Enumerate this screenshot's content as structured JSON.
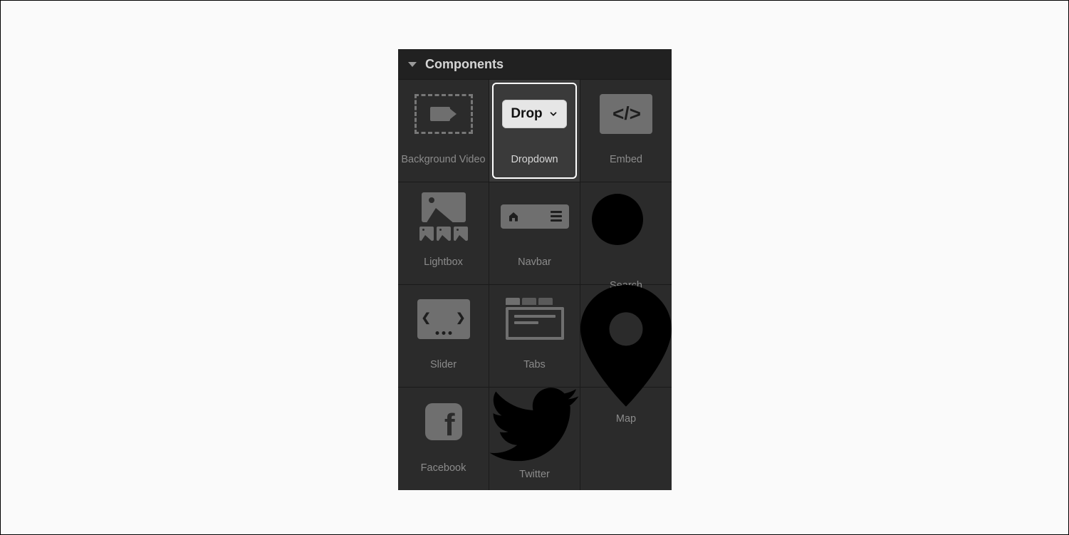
{
  "panel": {
    "title": "Components",
    "selected_index": 1,
    "dropdown_pill_text": "Drop",
    "items": [
      {
        "label": "Background Video",
        "icon": "background-video-icon"
      },
      {
        "label": "Dropdown",
        "icon": "dropdown-icon"
      },
      {
        "label": "Embed",
        "icon": "embed-icon"
      },
      {
        "label": "Lightbox",
        "icon": "lightbox-icon"
      },
      {
        "label": "Navbar",
        "icon": "navbar-icon"
      },
      {
        "label": "Search",
        "icon": "search-icon"
      },
      {
        "label": "Slider",
        "icon": "slider-icon"
      },
      {
        "label": "Tabs",
        "icon": "tabs-icon"
      },
      {
        "label": "Map",
        "icon": "map-pin-icon"
      },
      {
        "label": "Facebook",
        "icon": "facebook-icon"
      },
      {
        "label": "Twitter",
        "icon": "twitter-icon"
      }
    ]
  }
}
